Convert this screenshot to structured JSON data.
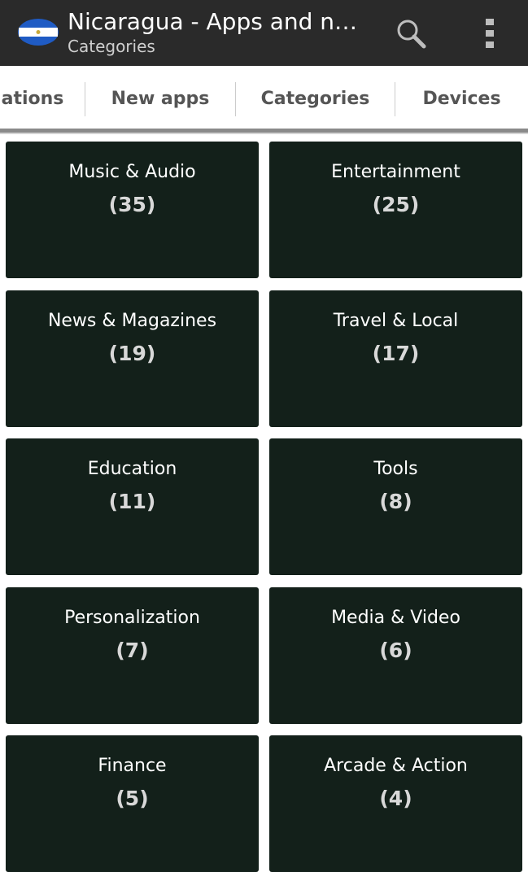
{
  "action_bar": {
    "title": "Nicaragua - Apps and ne...",
    "subtitle": "Categories",
    "app_icon": "nicaragua-flag-icon",
    "search_icon": "search-icon",
    "overflow_icon": "more-vertical-icon",
    "background": "#2a2a2a"
  },
  "tabs": [
    {
      "label": "ations"
    },
    {
      "label": "New apps"
    },
    {
      "label": "Categories"
    },
    {
      "label": "Devices"
    }
  ],
  "categories": [
    {
      "name": "Music & Audio",
      "count": "(35)"
    },
    {
      "name": "Entertainment",
      "count": "(25)"
    },
    {
      "name": "News & Magazines",
      "count": "(19)"
    },
    {
      "name": "Travel & Local",
      "count": "(17)"
    },
    {
      "name": "Education",
      "count": "(11)"
    },
    {
      "name": "Tools",
      "count": "(8)"
    },
    {
      "name": "Personalization",
      "count": "(7)"
    },
    {
      "name": "Media & Video",
      "count": "(6)"
    },
    {
      "name": "Finance",
      "count": "(5)"
    },
    {
      "name": "Arcade & Action",
      "count": "(4)"
    }
  ],
  "colors": {
    "tile_background": "#13201a",
    "flag_blue": "#1f5bc4"
  }
}
